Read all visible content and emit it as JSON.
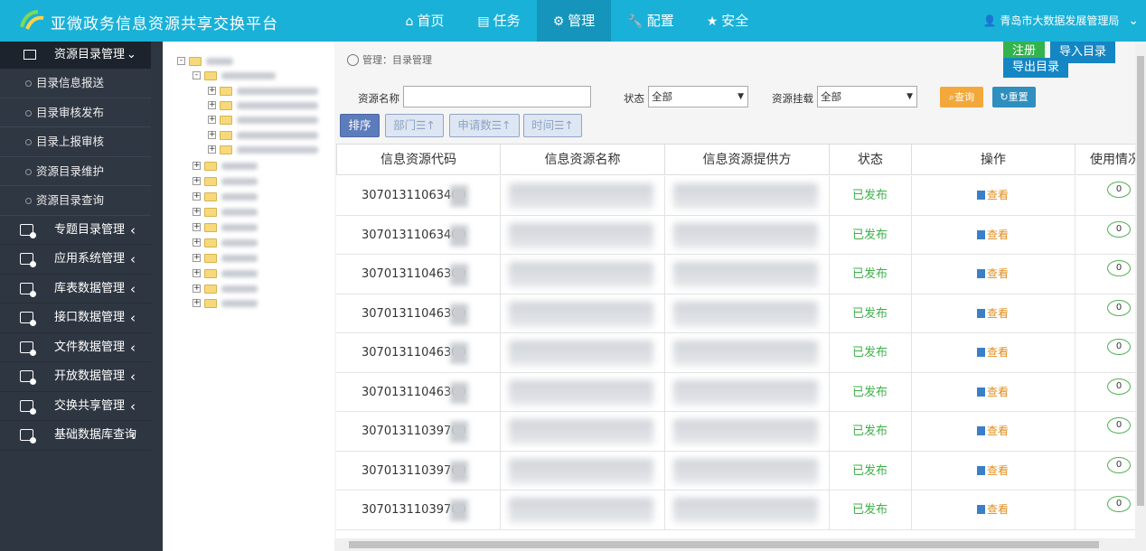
{
  "header": {
    "app_title": "亚微政务信息资源共享交换平台",
    "nav": [
      {
        "label": "首页",
        "icon": "home-icon"
      },
      {
        "label": "任务",
        "icon": "file-icon"
      },
      {
        "label": "管理",
        "icon": "gear-icon",
        "active": true
      },
      {
        "label": "配置",
        "icon": "wrench-icon"
      },
      {
        "label": "安全",
        "icon": "star-icon"
      }
    ],
    "user": "青岛市大数据发展管理局",
    "accent_color": "#1ab1d8"
  },
  "sidebar": {
    "main_section": "资源目录管理",
    "sub_items": [
      "目录信息报送",
      "目录审核发布",
      "目录上报审核",
      "资源目录维护",
      "资源目录查询"
    ],
    "sections": [
      "专题目录管理",
      "应用系统管理",
      "库表数据管理",
      "接口数据管理",
      "文件数据管理",
      "开放数据管理",
      "交换共享管理",
      "基础数据库查询"
    ]
  },
  "main": {
    "breadcrumb": "管理：目录管理",
    "buttons": {
      "register": "注册",
      "import": "导入目录",
      "export": "导出目录",
      "query": "查询",
      "reset": "重置"
    },
    "filters": {
      "name_label": "资源名称",
      "status_label": "状态",
      "status_value": "全部",
      "mount_label": "资源挂载",
      "mount_value": "全部"
    },
    "sort": {
      "label": "排序",
      "dept": "部门",
      "apply": "申请数",
      "time": "时间"
    },
    "table": {
      "headers": [
        "信息资源代码",
        "信息资源名称",
        "信息资源提供方",
        "状态",
        "操作",
        "使用情况"
      ],
      "rows": [
        {
          "code": "30701311063400",
          "status": "已发布",
          "op": "查看",
          "use": "0"
        },
        {
          "code": "30701311063400",
          "status": "已发布",
          "op": "查看",
          "use": "0"
        },
        {
          "code": "30701311046300",
          "status": "已发布",
          "op": "查看",
          "use": "0"
        },
        {
          "code": "30701311046300",
          "status": "已发布",
          "op": "查看",
          "use": "0"
        },
        {
          "code": "30701311046300",
          "status": "已发布",
          "op": "查看",
          "use": "0"
        },
        {
          "code": "30701311046300",
          "status": "已发布",
          "op": "查看",
          "use": "0"
        },
        {
          "code": "30701311039700",
          "status": "已发布",
          "op": "查看",
          "use": "0"
        },
        {
          "code": "30701311039700",
          "status": "已发布",
          "op": "查看",
          "use": "0"
        },
        {
          "code": "30701311039700",
          "status": "已发布",
          "op": "查看",
          "use": "0"
        }
      ]
    }
  }
}
